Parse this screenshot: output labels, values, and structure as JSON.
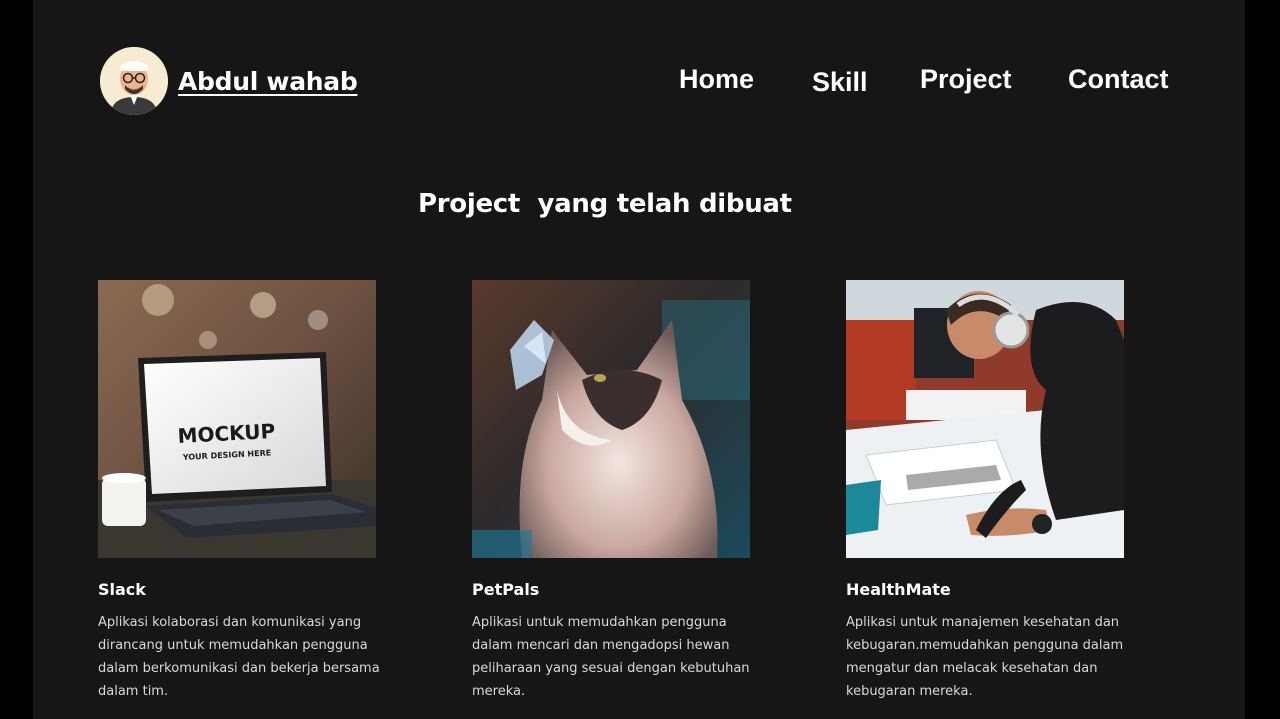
{
  "header": {
    "brand_name": "Abdul wahab",
    "avatar_icon": "profile-avatar-icon",
    "nav": [
      {
        "label": "Home"
      },
      {
        "label": "Skill"
      },
      {
        "label": "Project"
      },
      {
        "label": "Contact"
      }
    ]
  },
  "projects": {
    "title": "Project  yang telah dibuat",
    "items": [
      {
        "title": "Slack",
        "description": "Aplikasi kolaborasi dan komunikasi yang dirancang untuk memudahkan pengguna dalam berkomunikasi dan bekerja bersama dalam tim.",
        "image_text_1": "MOCKUP",
        "image_text_2": "YOUR DESIGN HERE"
      },
      {
        "title": "PetPals",
        "description": "Aplikasi untuk memudahkan pengguna dalam mencari dan mengadopsi hewan peliharaan yang sesuai dengan kebutuhan mereka."
      },
      {
        "title": "HealthMate",
        "description": "Aplikasi untuk manajemen kesehatan dan kebugaran.memudahkan pengguna dalam mengatur dan melacak kesehatan dan kebugaran mereka."
      }
    ]
  },
  "colors": {
    "page_background": "#161616",
    "outer_background": "#000000",
    "text_primary": "#ffffff",
    "text_secondary": "#d9d9d9"
  }
}
